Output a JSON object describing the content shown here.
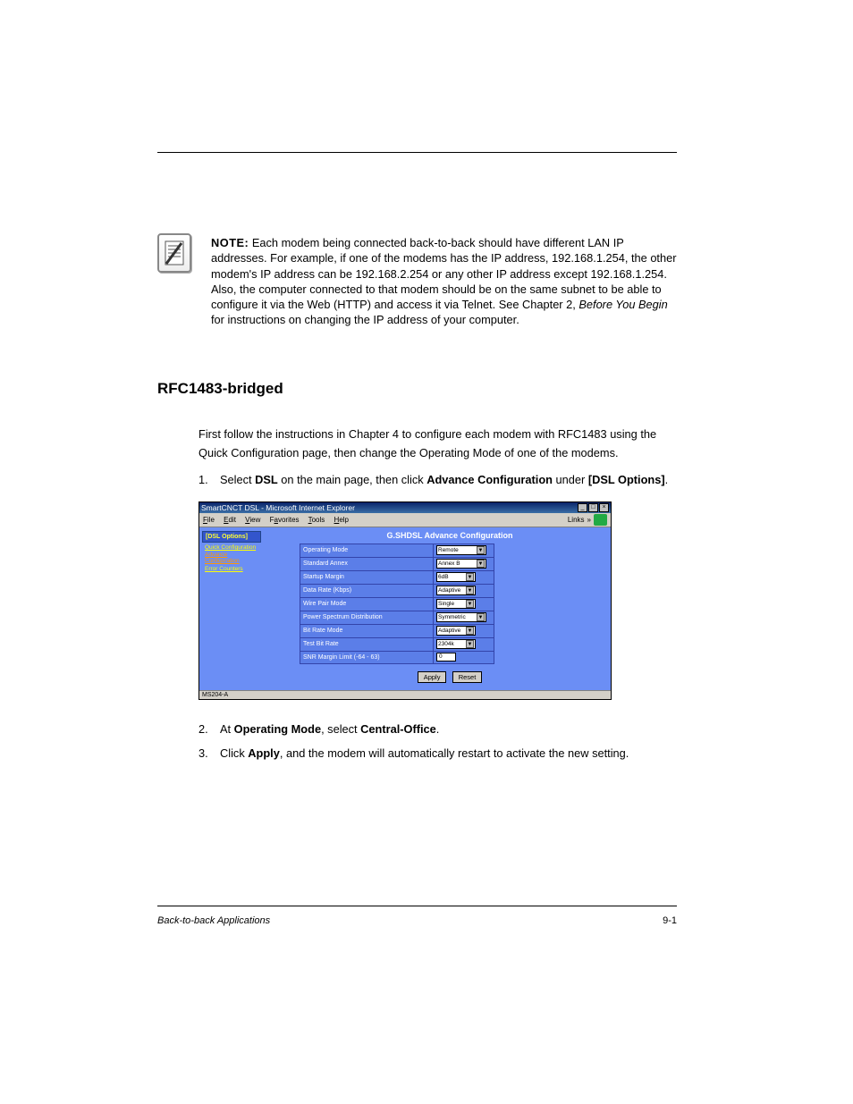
{
  "note": {
    "label": "NOTE:",
    "text_1": " Each modem being connected back-to-back should have different LAN IP addresses. For example, if one of the modems has the IP address, 192.168.1.254, the other modem's IP address can be 192.168.2.254 or any other IP address except 192.168.1.254. Also, the computer connected to that modem should be on the same subnet to be able to configure it via the Web (HTTP) and access it via Telnet. See Chapter 2, ",
    "text_2": " for instructions on changing the IP address of your computer."
  },
  "section_title": "RFC1483-bridged",
  "intro_1": "First follow the instructions in Chapter 4 to configure each modem with RFC1483 using the Quick Configuration page, then change the Operating Mode of one of the modems.",
  "step1_before": "Select ",
  "step1_dsl": "DSL",
  "step1_mid": " on the main page, then click ",
  "step1_ac": "Advance Configuration",
  "step1_under": " under ",
  "step1_opt": "[DSL Options]",
  "step1_after": ".",
  "screenshot": {
    "title": "SmartCNCT DSL - Microsoft Internet Explorer",
    "menus": [
      "File",
      "Edit",
      "View",
      "Favorites",
      "Tools",
      "Help"
    ],
    "links_label": "Links",
    "side_header": "[DSL Options]",
    "side_links": [
      "Quick Configuration",
      "Advance Configuration",
      "Error Counters"
    ],
    "main_title": "G.SHDSL Advance Configuration",
    "rows": [
      {
        "label": "Operating Mode",
        "value": "Remote",
        "type": "select"
      },
      {
        "label": "Standard Annex",
        "value": "Annex B",
        "type": "select"
      },
      {
        "label": "Startup Margin",
        "value": "6dB",
        "type": "select-narrow"
      },
      {
        "label": "Data Rate (Kbps)",
        "value": "Adaptive",
        "type": "select-narrow"
      },
      {
        "label": "Wire Pair Mode",
        "value": "Single",
        "type": "select-narrow"
      },
      {
        "label": "Power Spectrum Distribution",
        "value": "Symmetric",
        "type": "select"
      },
      {
        "label": "Bit Rate Mode",
        "value": "Adaptive",
        "type": "select-narrow"
      },
      {
        "label": "Test Bit Rate",
        "value": "2304k",
        "type": "select-narrow"
      },
      {
        "label": "SNR Margin Limit (-64 - 63)",
        "value": "0",
        "type": "input"
      }
    ],
    "apply": "Apply",
    "reset": "Reset",
    "status": "MS204-A"
  },
  "step2_before": "At ",
  "step2_om": "Operating Mode",
  "step2_mid": ", select ",
  "step2_co": "Central-Office",
  "step2_after": ".",
  "step3_before": "Click ",
  "step3_apply": "Apply",
  "step3_after": ", and the modem will automatically restart to activate the new setting.",
  "footer_left": "Back-to-back Applications",
  "footer_right": "9-1",
  "chart_data": null
}
